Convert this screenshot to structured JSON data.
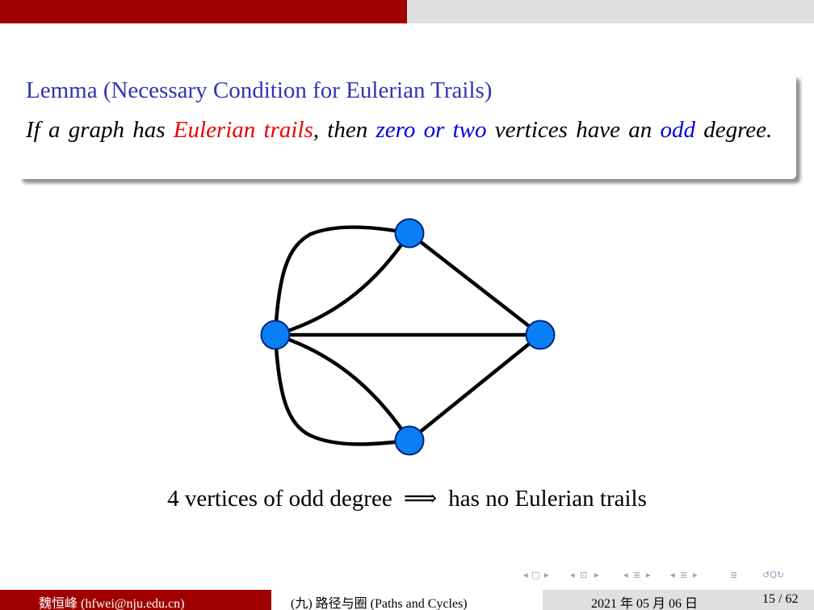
{
  "progress": {
    "fraction": 0.5
  },
  "lemma": {
    "title": "Lemma (Necessary Condition for Eulerian Trails)",
    "body": {
      "t1": "If a graph has ",
      "t2": "Eulerian trails",
      "t3": ", then ",
      "t4": "zero or two",
      "t5": " vertices have an ",
      "t6": "odd",
      "t7": " degree."
    }
  },
  "caption": {
    "left": "4 vertices of odd degree",
    "arrow": "⟹",
    "right": "has no Eulerian trails"
  },
  "nav": {
    "frame_prev": "◂",
    "frame_icon": "□",
    "frame_next": "▸",
    "sub_prev": "◂",
    "sub_icon": "⊡",
    "sub_next": "▸",
    "sec_prev": "◂",
    "sec_icon": "≣",
    "sec_next": "▸",
    "ssec_prev": "◂",
    "ssec_icon": "≣",
    "ssec_next": "▸",
    "toc_icon": "≣",
    "search_icon": "↺Q↻"
  },
  "footer": {
    "author": "魏恒峰 (hfwei@nju.edu.cn)",
    "title": "(九) 路径与圈 (Paths and Cycles)",
    "date": "2021 年 05 月 06 日",
    "page": "15 / 62"
  },
  "colors": {
    "frame_red": "#a00000",
    "title_blue": "#3333b3",
    "emph_red": "#ee0000",
    "emph_blue": "#0000dd",
    "vertex_fill": "#0a7ff5",
    "vertex_stroke": "#00247a"
  }
}
